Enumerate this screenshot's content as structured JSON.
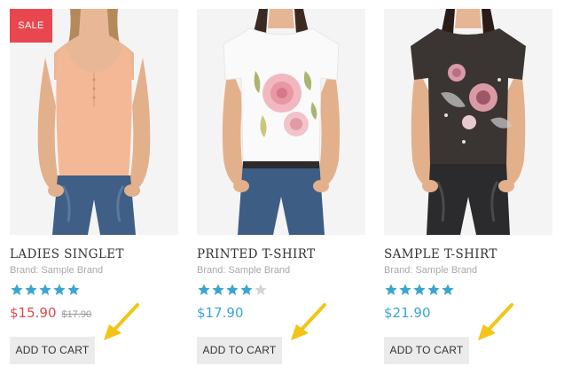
{
  "products": [
    {
      "title": "LADIES SINGLET",
      "brand": "Brand: Sample Brand",
      "rating": 5,
      "price": "$15.90",
      "old_price": "$17.90",
      "on_sale": true,
      "badge": "SALE",
      "button_label": "ADD TO CART",
      "price_color": "#e0474f"
    },
    {
      "title": "PRINTED T-SHIRT",
      "brand": "Brand: Sample Brand",
      "rating": 4,
      "price": "$17.90",
      "button_label": "ADD TO CART",
      "price_color": "#3aa6d0"
    },
    {
      "title": "SAMPLE T-SHIRT",
      "brand": "Brand: Sample Brand",
      "rating": 5,
      "price": "$21.90",
      "button_label": "ADD TO CART",
      "price_color": "#3aa6d0"
    }
  ],
  "colors": {
    "sale_badge": "#e8474f",
    "star_filled": "#3aa6d0",
    "star_empty": "#d6d6d6",
    "arrow": "#f3c316",
    "button_bg": "#ebebeb"
  }
}
